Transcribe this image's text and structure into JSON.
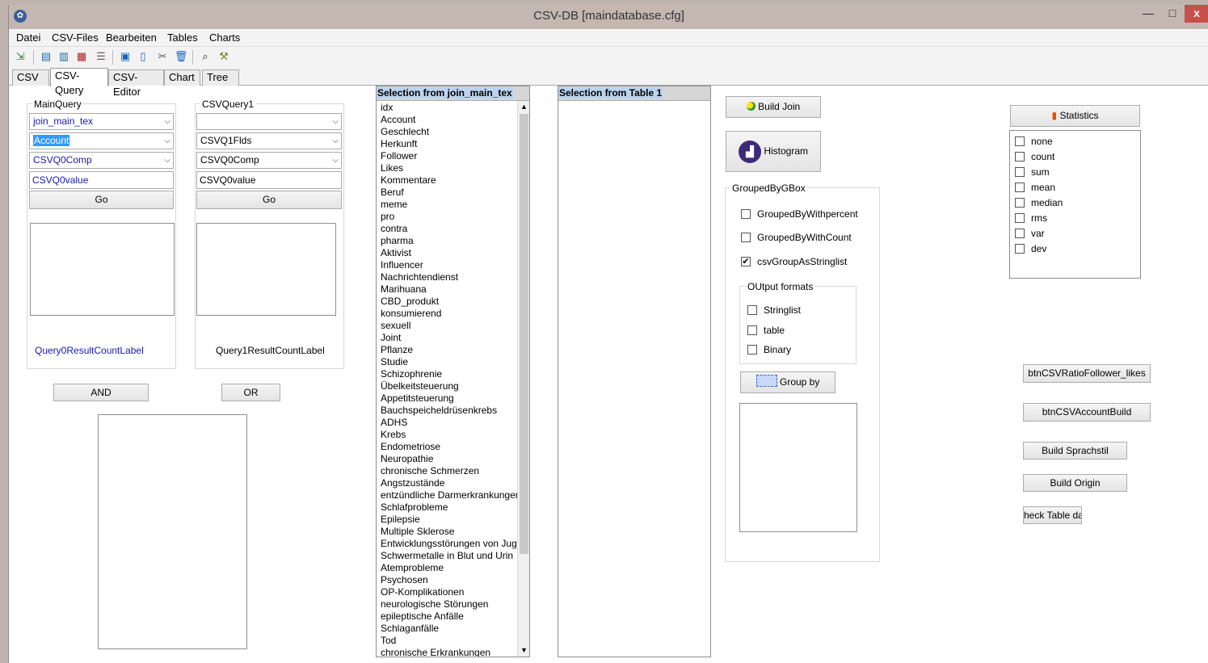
{
  "window": {
    "title": "CSV-DB [maindatabase.cfg]",
    "min": "—",
    "max": "□",
    "close": "x"
  },
  "menu": [
    "Datei",
    "CSV-Files",
    "Bearbeiten",
    "Tables",
    "Charts"
  ],
  "tabs": [
    "CSV",
    "CSV-Query",
    "CSV-Editor",
    "Chart",
    "Tree"
  ],
  "main_query": {
    "group_label": "MainQuery",
    "table": "join_main_tex",
    "field": "Account",
    "comp": "CSVQ0Comp",
    "value": "CSVQ0value",
    "go": "Go",
    "result_label": "Query0ResultCountLabel"
  },
  "query1": {
    "group_label": "CSVQuery1",
    "table": "",
    "field": "CSVQ1Flds",
    "comp": "CSVQ0Comp",
    "value": "CSVQ0value",
    "go": "Go",
    "result_label": "Query1ResultCountLabel"
  },
  "and_button": "AND",
  "or_button": "OR",
  "selection_join": {
    "header": "Selection from join_main_tex",
    "items": [
      "idx",
      "Account",
      "Geschlecht",
      "Herkunft",
      "Follower",
      "Likes",
      "Kommentare",
      "Beruf",
      "meme",
      "pro",
      "contra",
      "pharma",
      "Aktivist",
      "Influencer",
      "Nachrichtendienst",
      "Marihuana",
      "CBD_produkt",
      "konsumierend",
      "sexuell",
      "Joint",
      "Pflanze",
      "Studie",
      "Schizophrenie",
      "Übelkeitsteuerung",
      "Appetitsteuerung",
      "Bauchspeicheldrüsenkrebs",
      "ADHS",
      "Krebs",
      "Endometriose",
      "Neuropathie",
      "chronische Schmerzen",
      "Angstzustände",
      "entzündliche Darmerkrankungen",
      "Schlafprobleme",
      "Epilepsie",
      "Multiple Sklerose",
      "Entwicklungsstörungen von Jug",
      "Schwermetalle in Blut und Urin",
      "Atemprobleme",
      "Psychosen",
      "OP-Komplikationen",
      "neurologische Störungen",
      "epileptische Anfälle",
      "Schlaganfälle",
      "Tod",
      "chronische Erkrankungen"
    ]
  },
  "selection_table1": {
    "header": "Selection from Table 1"
  },
  "build_join": "Build Join",
  "histogram": "Histogram",
  "grouped_box": {
    "label": "GroupedByGBox",
    "options": [
      {
        "label": "GroupedByWithpercent",
        "checked": false
      },
      {
        "label": "GroupedByWithCount",
        "checked": false
      },
      {
        "label": "csvGroupAsStringlist",
        "checked": true
      }
    ],
    "output_formats": {
      "label": "OUtput formats",
      "options": [
        {
          "label": "Stringlist",
          "checked": false
        },
        {
          "label": "table",
          "checked": false
        },
        {
          "label": "Binary",
          "checked": false
        }
      ]
    },
    "group_by": "Group by"
  },
  "statistics": {
    "button": "Statistics",
    "options": [
      "none",
      "count",
      "sum",
      "mean",
      "median",
      "rms",
      "var",
      "dev"
    ]
  },
  "right_buttons": {
    "ratio": "btnCSVRatioFollower_likes",
    "account_build": "btnCSVAccountBuild",
    "sprachstil": "Build Sprachstil",
    "origin": "Build Origin",
    "check_table": "heck Table da"
  },
  "check_mark": "✔"
}
